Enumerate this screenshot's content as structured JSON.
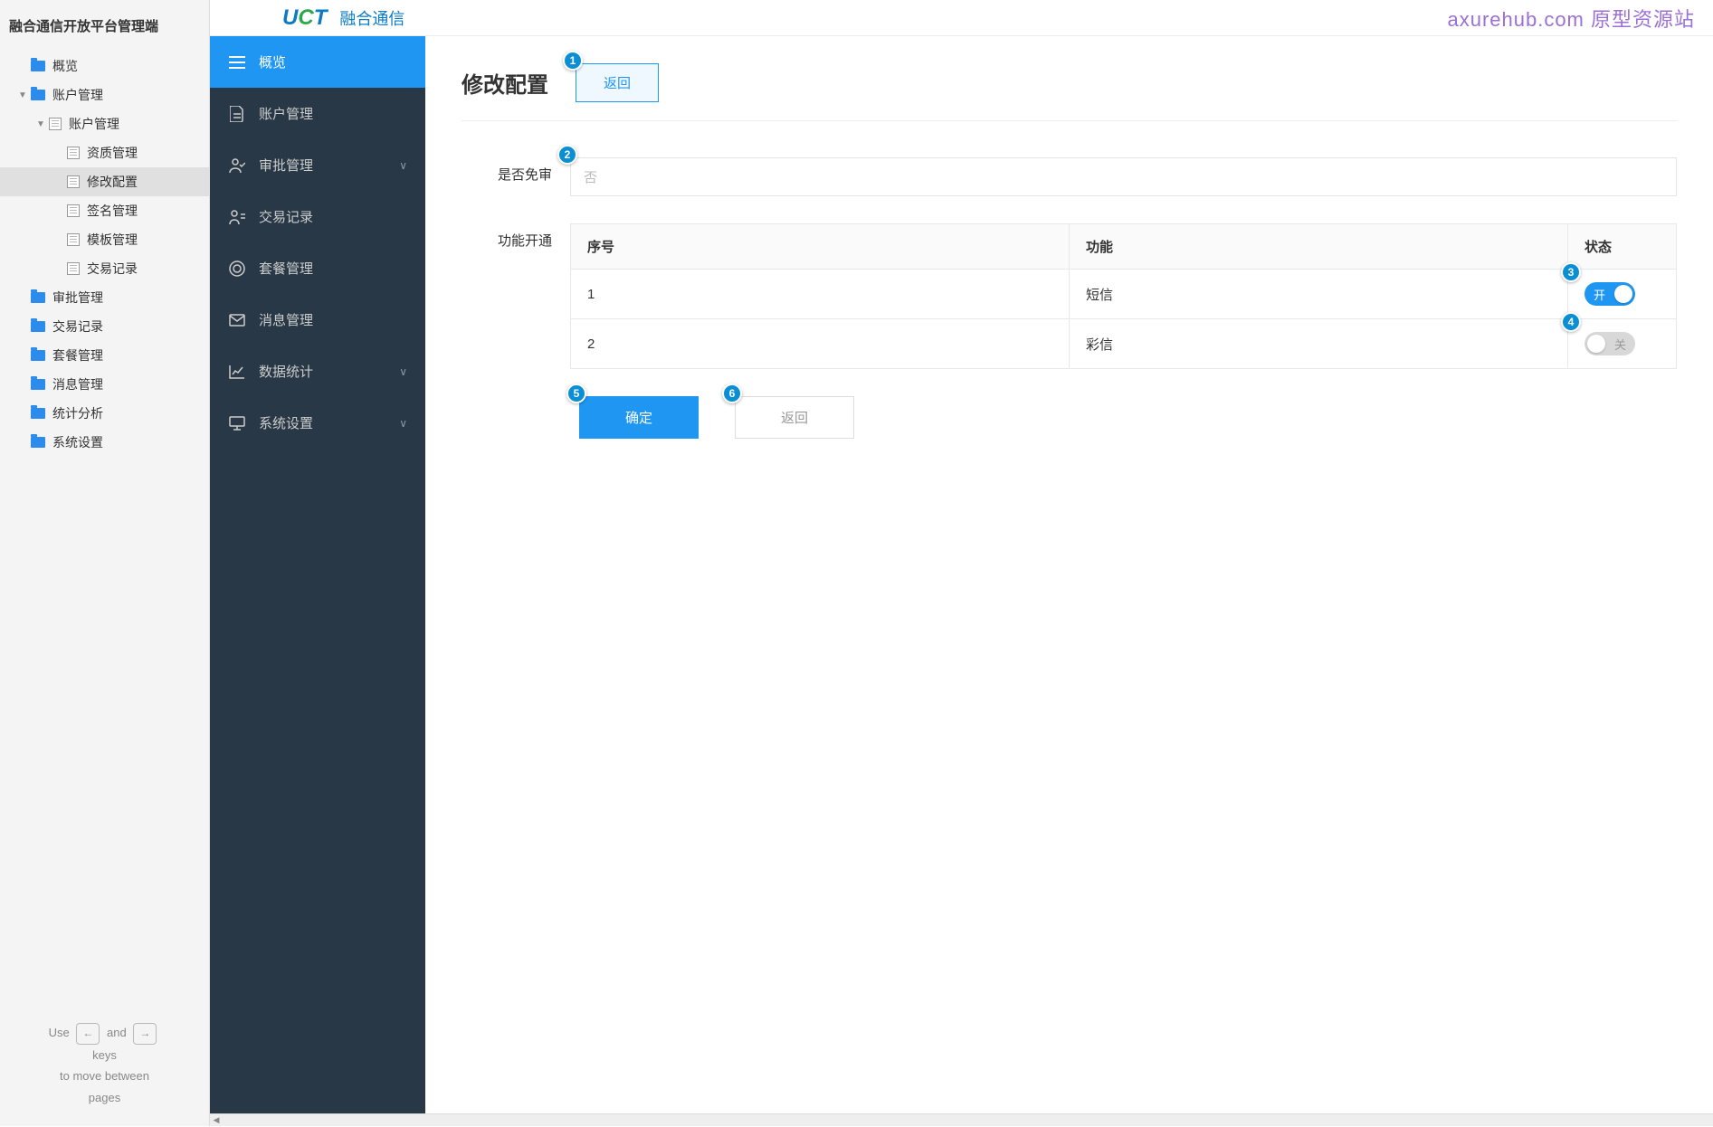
{
  "tree": {
    "title": "融合通信开放平台管理端",
    "items": [
      {
        "label": "概览",
        "type": "folder",
        "indent": 1
      },
      {
        "label": "账户管理",
        "type": "folder",
        "indent": 1,
        "expanded": true
      },
      {
        "label": "账户管理",
        "type": "page",
        "indent": 2,
        "expanded": true
      },
      {
        "label": "资质管理",
        "type": "page",
        "indent": 3
      },
      {
        "label": "修改配置",
        "type": "page",
        "indent": 3,
        "selected": true
      },
      {
        "label": "签名管理",
        "type": "page",
        "indent": 3
      },
      {
        "label": "模板管理",
        "type": "page",
        "indent": 3
      },
      {
        "label": "交易记录",
        "type": "page",
        "indent": 3
      },
      {
        "label": "审批管理",
        "type": "folder",
        "indent": 1
      },
      {
        "label": "交易记录",
        "type": "folder",
        "indent": 1
      },
      {
        "label": "套餐管理",
        "type": "folder",
        "indent": 1
      },
      {
        "label": "消息管理",
        "type": "folder",
        "indent": 1
      },
      {
        "label": "统计分析",
        "type": "folder",
        "indent": 1
      },
      {
        "label": "系统设置",
        "type": "folder",
        "indent": 1
      }
    ],
    "hint": {
      "use": "Use",
      "and": "and",
      "keys": "keys",
      "move": "to move between",
      "pages": "pages",
      "left": "←",
      "right": "→"
    }
  },
  "header": {
    "logo_sub": "融合通信",
    "watermark": "axurehub.com 原型资源站"
  },
  "sidebar": {
    "items": [
      {
        "label": "概览",
        "icon": "menu",
        "active": true
      },
      {
        "label": "账户管理",
        "icon": "doc"
      },
      {
        "label": "审批管理",
        "icon": "user-check",
        "chevron": true
      },
      {
        "label": "交易记录",
        "icon": "user-list"
      },
      {
        "label": "套餐管理",
        "icon": "target"
      },
      {
        "label": "消息管理",
        "icon": "mail"
      },
      {
        "label": "数据统计",
        "icon": "chart",
        "chevron": true
      },
      {
        "label": "系统设置",
        "icon": "monitor",
        "chevron": true
      }
    ]
  },
  "page": {
    "title": "修改配置",
    "back_label": "返回",
    "form": {
      "exempt_label": "是否免审",
      "exempt_value": "否",
      "features_label": "功能开通"
    },
    "table": {
      "headers": {
        "seq": "序号",
        "feature": "功能",
        "status": "状态"
      },
      "rows": [
        {
          "seq": "1",
          "feature": "短信",
          "on": true,
          "on_label": "开"
        },
        {
          "seq": "2",
          "feature": "彩信",
          "on": false,
          "off_label": "关"
        }
      ]
    },
    "buttons": {
      "confirm": "确定",
      "cancel": "返回"
    },
    "annotations": [
      "1",
      "2",
      "3",
      "4",
      "5",
      "6"
    ]
  }
}
